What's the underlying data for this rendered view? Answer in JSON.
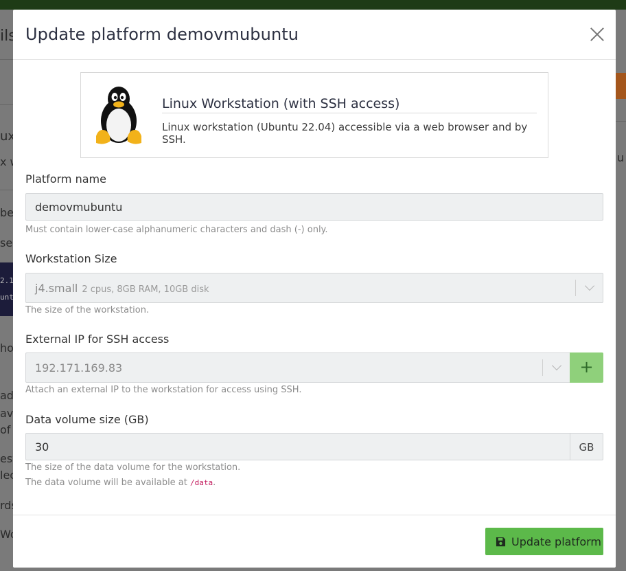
{
  "background": {
    "fragments": [
      "ils",
      "ux",
      "x w",
      "be",
      "se",
      "2.1",
      "unt",
      "hou",
      "adr",
      "ava",
      "of",
      "esy",
      "lec",
      "rds",
      "Wor",
      "u"
    ]
  },
  "modal": {
    "title": "Update platform demovmubuntu",
    "template_card": {
      "title": "Linux Workstation (with SSH access)",
      "description": "Linux workstation (Ubuntu 22.04) accessible via a web browser and by SSH.",
      "icon": "tux-penguin-icon"
    },
    "platform_name": {
      "label": "Platform name",
      "value": "demovmubuntu",
      "help": "Must contain lower-case alphanumeric characters and dash (-) only."
    },
    "workstation_size": {
      "label": "Workstation Size",
      "value": "j4.small",
      "detail": "2 cpus, 8GB RAM, 10GB disk",
      "help": "The size of the workstation."
    },
    "external_ip": {
      "label": "External IP for SSH access",
      "value": "192.171.169.83",
      "add_label": "+",
      "help": "Attach an external IP to the workstation for access using SSH."
    },
    "data_volume": {
      "label": "Data volume size (GB)",
      "value": "30",
      "unit": "GB",
      "help": "The size of the data volume for the workstation.",
      "help2_prefix": "The data volume will be available at ",
      "help2_path": "/data",
      "help2_suffix": "."
    },
    "submit_label": "Update platform"
  },
  "colors": {
    "primary_green": "#5cb94a",
    "add_button_green": "#8fd07b",
    "code_pink": "#c2185b"
  }
}
